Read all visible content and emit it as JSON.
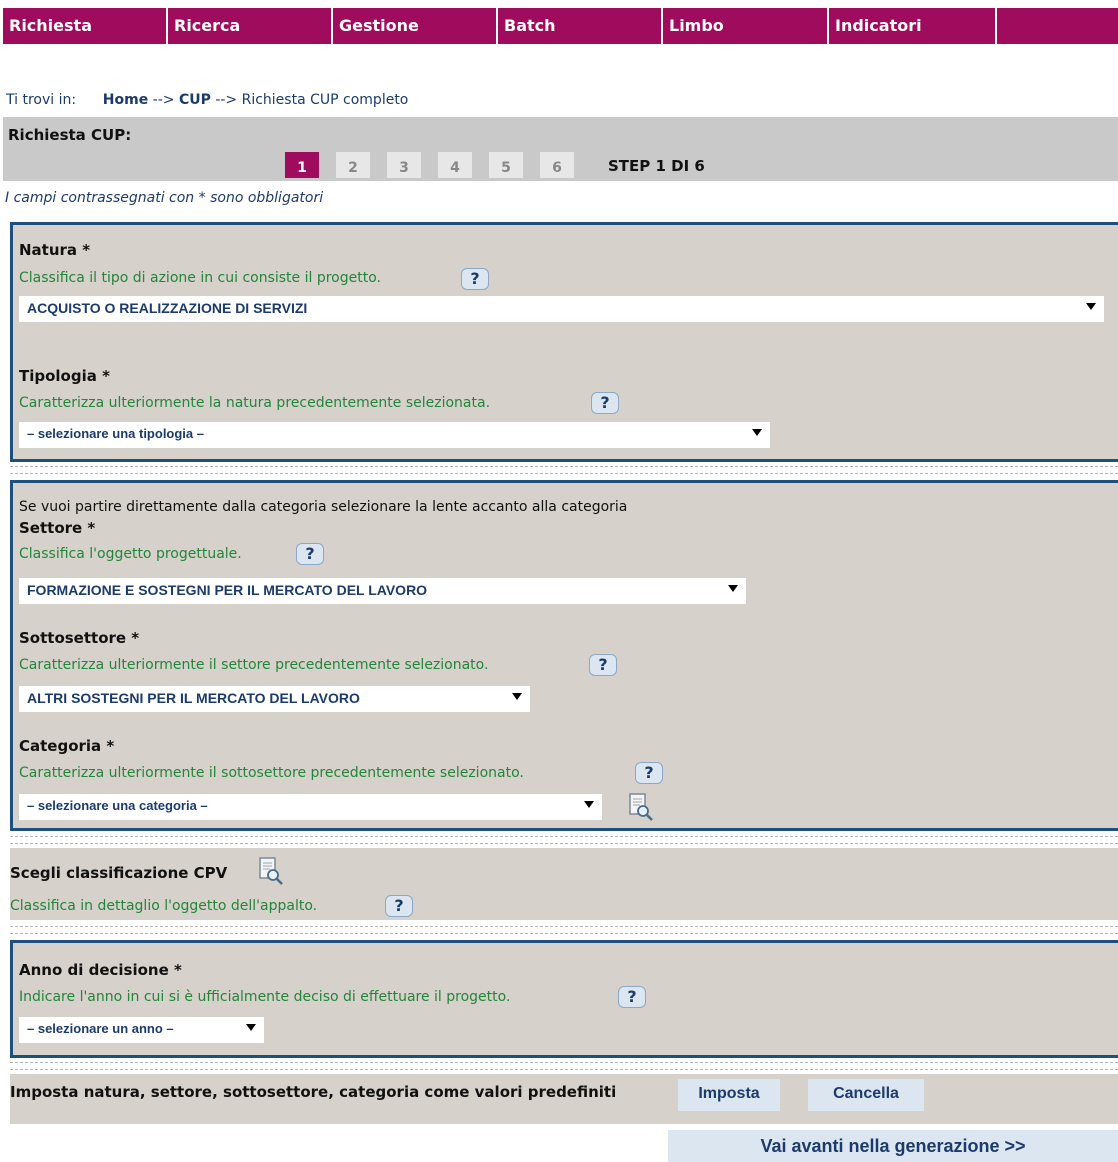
{
  "nav": [
    "Richiesta",
    "Ricerca",
    "Gestione",
    "Batch",
    "Limbo",
    "Indicatori"
  ],
  "breadcrumb": {
    "prefix": "Ti trovi in:",
    "home": "Home",
    "sep1": "-->",
    "cup": "CUP",
    "sep2": "-->",
    "current": "Richiesta CUP completo"
  },
  "steps": {
    "title": "Richiesta CUP:",
    "items": [
      "1",
      "2",
      "3",
      "4",
      "5",
      "6"
    ],
    "active": "1",
    "count": "STEP 1 DI 6"
  },
  "mandatory_note": "I campi contrassegnati con * sono obbligatori",
  "natura": {
    "label": "Natura *",
    "hint": "Classifica il tipo di azione in cui consiste il progetto.",
    "value": "ACQUISTO O REALIZZAZIONE DI SERVIZI"
  },
  "tipologia": {
    "label": "Tipologia *",
    "hint": "Caratterizza ulteriormente la natura precedentemente selezionata.",
    "value": "– selezionare una tipologia –"
  },
  "category_intro": "Se vuoi partire direttamente dalla categoria selezionare la lente accanto alla categoria",
  "settore": {
    "label": "Settore *",
    "hint": "Classifica l'oggetto progettuale.",
    "value": "FORMAZIONE E SOSTEGNI PER IL MERCATO DEL LAVORO"
  },
  "sottosettore": {
    "label": "Sottosettore *",
    "hint": "Caratterizza ulteriormente il settore precedentemente selezionato.",
    "value": "ALTRI SOSTEGNI PER IL MERCATO DEL LAVORO"
  },
  "categoria": {
    "label": "Categoria *",
    "hint": "Caratterizza ulteriormente il sottosettore precedentemente selezionato.",
    "value": "– selezionare una categoria –"
  },
  "cpv": {
    "label": "Scegli classificazione CPV",
    "hint": "Classifica in dettaglio l'oggetto dell'appalto."
  },
  "anno": {
    "label": "Anno di decisione *",
    "hint": "Indicare l'anno in cui si è ufficialmente deciso di effettuare il progetto.",
    "value": "– selezionare un anno –"
  },
  "defaults": {
    "label": "Imposta natura, settore, sottosettore, categoria come valori predefiniti",
    "imposta": "Imposta",
    "cancella": "Cancella"
  },
  "help_symbol": "?",
  "next_button": "Vai avanti nella generazione >>",
  "colors": {
    "brand": "#a00c5d",
    "panel": "#d6d1ca",
    "border": "#1f4f7f",
    "hint": "#23853a",
    "link": "#1c3b6b"
  }
}
